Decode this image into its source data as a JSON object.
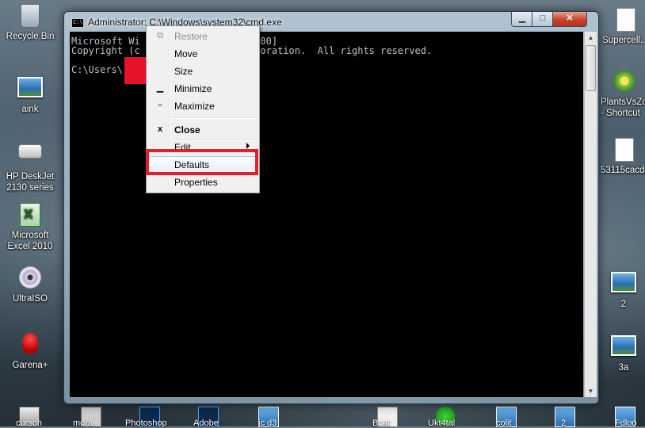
{
  "desktop": {
    "left_icons": [
      {
        "label": "Recycle Bin",
        "icon": "recycle-bin-icon"
      },
      {
        "label": "aink",
        "icon": "picture-icon"
      },
      {
        "label": "HP DeskJet 2130 series",
        "icon": "printer-icon"
      },
      {
        "label": "Microsoft Excel 2010",
        "icon": "excel-icon"
      },
      {
        "label": "UltraISO",
        "icon": "disc-icon"
      },
      {
        "label": "Garena+",
        "icon": "garena-icon"
      }
    ],
    "right_icons": [
      {
        "label": "Supercell...",
        "icon": "document-icon"
      },
      {
        "label": "PlantsVsZo... - Shortcut",
        "icon": "plants-icon"
      },
      {
        "label": "53115cacd...",
        "icon": "document-icon"
      },
      {
        "label": "2",
        "icon": "picture-icon"
      },
      {
        "label": "3a",
        "icon": "picture-icon"
      }
    ],
    "bottom_labels": [
      "cursoh",
      "mdra...",
      "Photoshop",
      "Adobe",
      "jc d3",
      "Bc4t",
      "Ukt4tal",
      "colit",
      "2",
      "Fdloo"
    ]
  },
  "window": {
    "title": "Administrator: C:\\Windows\\system32\\cmd.exe",
    "buttons": {
      "minimize": "▁",
      "maximize": "□",
      "close": "✕"
    }
  },
  "console": {
    "lines": [
      "Microsoft Wi                  .7600]",
      "Copyright (c                  orporation.  All rights reserved.",
      "",
      "C:\\Users\\"
    ]
  },
  "context_menu": {
    "items": [
      {
        "label": "Restore",
        "icon": "restore-icon",
        "glyph": "⧉",
        "state": "disabled"
      },
      {
        "label": "Move",
        "icon": "",
        "glyph": "",
        "state": "normal"
      },
      {
        "label": "Size",
        "icon": "",
        "glyph": "",
        "state": "normal"
      },
      {
        "label": "Minimize",
        "icon": "minimize-icon",
        "glyph": "▁",
        "state": "normal"
      },
      {
        "label": "Maximize",
        "icon": "maximize-icon",
        "glyph": "▫",
        "state": "normal"
      },
      {
        "label": "Close",
        "icon": "close-icon",
        "glyph": "x",
        "state": "bold"
      },
      {
        "label": "Edit",
        "icon": "",
        "glyph": "",
        "state": "submenu"
      },
      {
        "label": "Defaults",
        "icon": "",
        "glyph": "",
        "state": "highlighted"
      },
      {
        "label": "Properties",
        "icon": "",
        "glyph": "",
        "state": "normal"
      }
    ]
  },
  "colors": {
    "console_bg": "#000000",
    "console_text": "#c0c0c0",
    "highlight_border": "#e51c2a",
    "redaction": "#e8122a"
  }
}
